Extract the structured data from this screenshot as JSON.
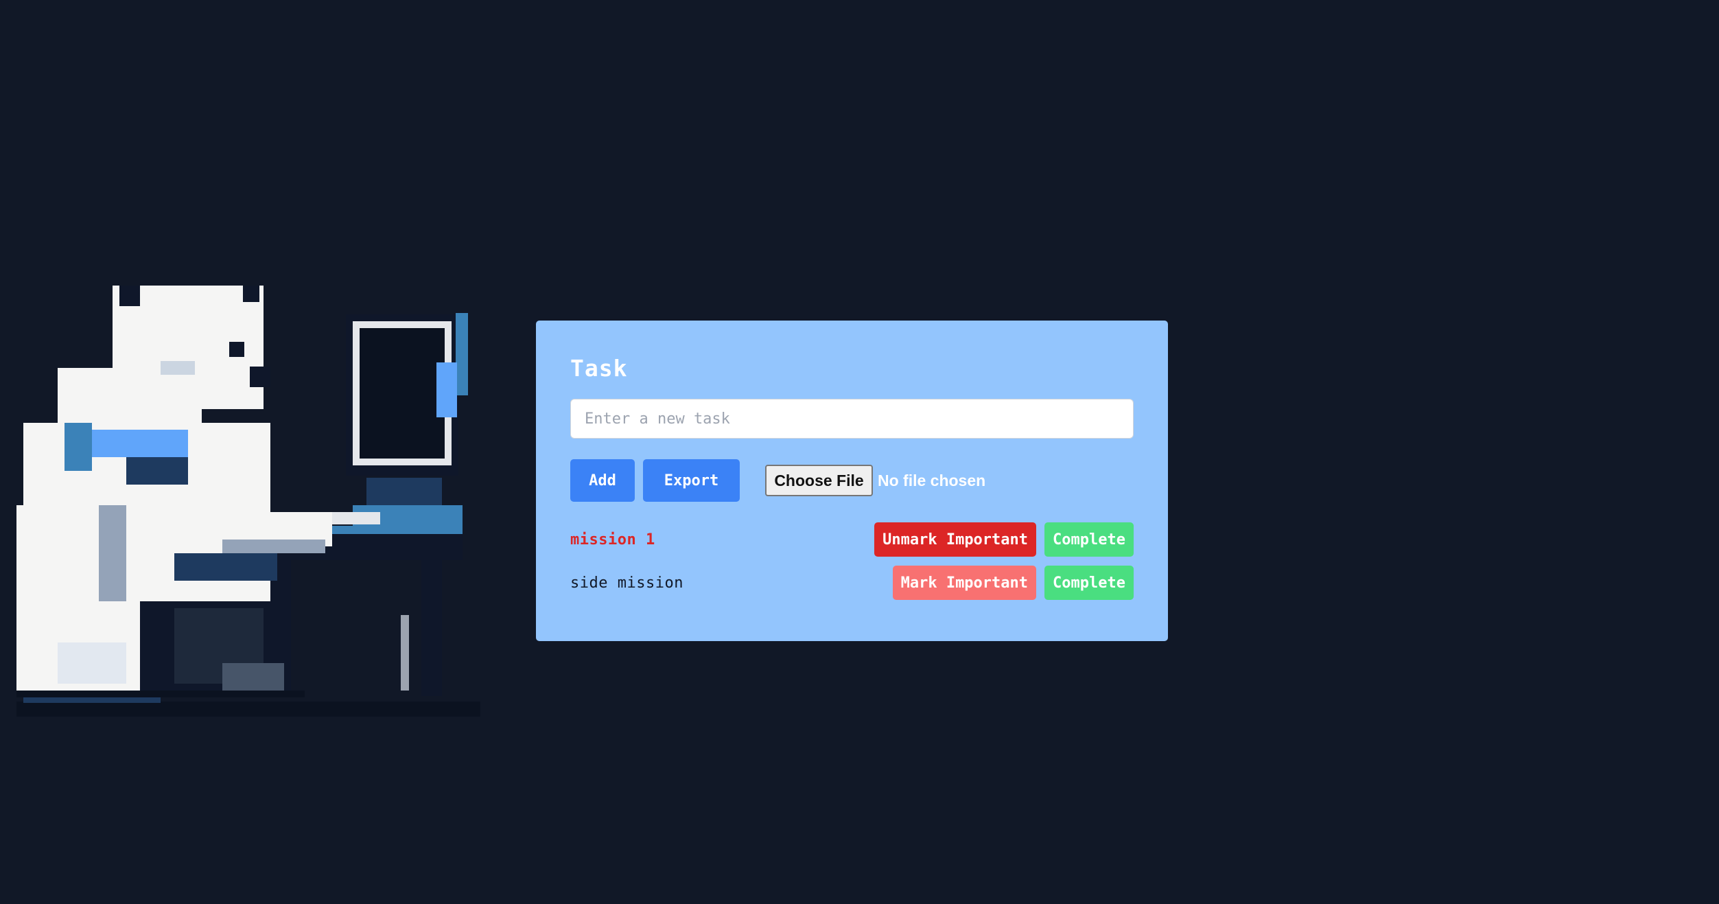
{
  "illustration": {
    "icon": "polar-bear-at-computer-pixel-art"
  },
  "todo": {
    "title": "Task",
    "input": {
      "placeholder": "Enter a new task",
      "value": ""
    },
    "buttons": {
      "add": "Add",
      "export": "Export"
    },
    "file_picker": {
      "button_label": "Choose File",
      "status": "No file chosen"
    },
    "tasks": [
      {
        "name": "mission 1",
        "important": true,
        "important_toggle_label": "Unmark Important",
        "complete_label": "Complete"
      },
      {
        "name": "side mission",
        "important": false,
        "important_toggle_label": "Mark Important",
        "complete_label": "Complete"
      }
    ]
  },
  "colors": {
    "background": "#111827",
    "card": "#93c5fd",
    "primary_button": "#3b82f6",
    "important_active": "#dc2626",
    "important_inactive": "#f87171",
    "complete": "#4ade80"
  }
}
